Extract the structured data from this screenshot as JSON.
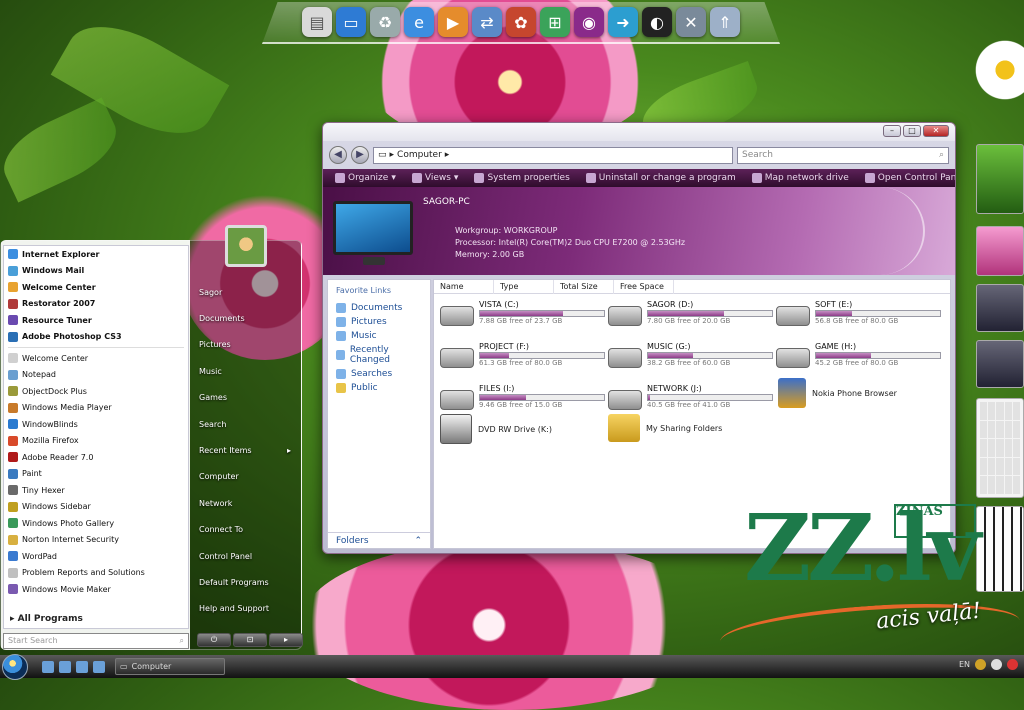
{
  "explorer": {
    "address": "Computer",
    "search_placeholder": "Search",
    "toolbar": [
      "Organize",
      "Views",
      "System properties",
      "Uninstall or change a program",
      "Map network drive",
      "Open Control Panel"
    ],
    "computer_name": "SAGOR-PC",
    "workgroup": "Workgroup: WORKGROUP",
    "processor": "Processor: Intel(R) Core(TM)2 Duo CPU   E7200 @ 2.53GHz",
    "memory": "Memory: 2.00 GB",
    "favorite_links_title": "Favorite Links",
    "favorite_links": [
      "Documents",
      "Pictures",
      "Music",
      "Recently Changed",
      "Searches",
      "Public"
    ],
    "folders_label": "Folders",
    "columns": [
      "Name",
      "Type",
      "Total Size",
      "Free Space"
    ],
    "drives": [
      {
        "name": "VISTA (C:)",
        "free_text": "7.88 GB free of 23.7 GB",
        "used_fraction": 0.67
      },
      {
        "name": "SAGOR (D:)",
        "free_text": "7.80 GB free of 20.0 GB",
        "used_fraction": 0.61
      },
      {
        "name": "SOFT (E:)",
        "free_text": "56.8 GB free of 80.0 GB",
        "used_fraction": 0.29
      },
      {
        "name": "PROJECT (F:)",
        "free_text": "61.3 GB free of 80.0 GB",
        "used_fraction": 0.23
      },
      {
        "name": "MUSIC (G:)",
        "free_text": "38.2 GB free of 60.0 GB",
        "used_fraction": 0.36
      },
      {
        "name": "GAME (H:)",
        "free_text": "45.2 GB free of 80.0 GB",
        "used_fraction": 0.44
      },
      {
        "name": "FILES (I:)",
        "free_text": "9.46 GB free of 15.0 GB",
        "used_fraction": 0.37
      },
      {
        "name": "NETWORK (J:)",
        "free_text": "40.5 GB free of 41.0 GB",
        "used_fraction": 0.02
      }
    ],
    "specials": [
      "Nokia Phone Browser",
      "DVD RW Drive (K:)",
      "My Sharing Folders"
    ]
  },
  "start_menu": {
    "pinned": [
      "Internet Explorer",
      "Windows Mail",
      "Welcome Center",
      "Restorator 2007",
      "Resource Tuner",
      "Adobe Photoshop CS3"
    ],
    "recent": [
      "Welcome Center",
      "Notepad",
      "ObjectDock Plus",
      "Windows Media Player",
      "WindowBlinds",
      "Mozilla Firefox",
      "Adobe Reader 7.0",
      "Paint",
      "Tiny Hexer",
      "Windows Sidebar",
      "Windows Photo Gallery",
      "Norton Internet Security",
      "WordPad",
      "Problem Reports and Solutions",
      "Windows Movie Maker"
    ],
    "all_programs": "All Programs",
    "search_placeholder": "Start Search",
    "right_links": [
      "Sagor",
      "Documents",
      "Pictures",
      "Music",
      "Games",
      "Search",
      "Recent Items",
      "Computer",
      "Network",
      "Connect To",
      "Control Panel",
      "Default Programs",
      "Help and Support"
    ]
  },
  "taskbar": {
    "window_button": "Computer",
    "lang": "EN"
  },
  "logo": {
    "letters": "ZZ.lv",
    "word": "ZIŅAS",
    "slogan": "acis vaļā!"
  },
  "colors": {
    "accent": "#8d3d89",
    "logo_green": "#1d7a4a",
    "slogan_orange": "#e5672a"
  }
}
